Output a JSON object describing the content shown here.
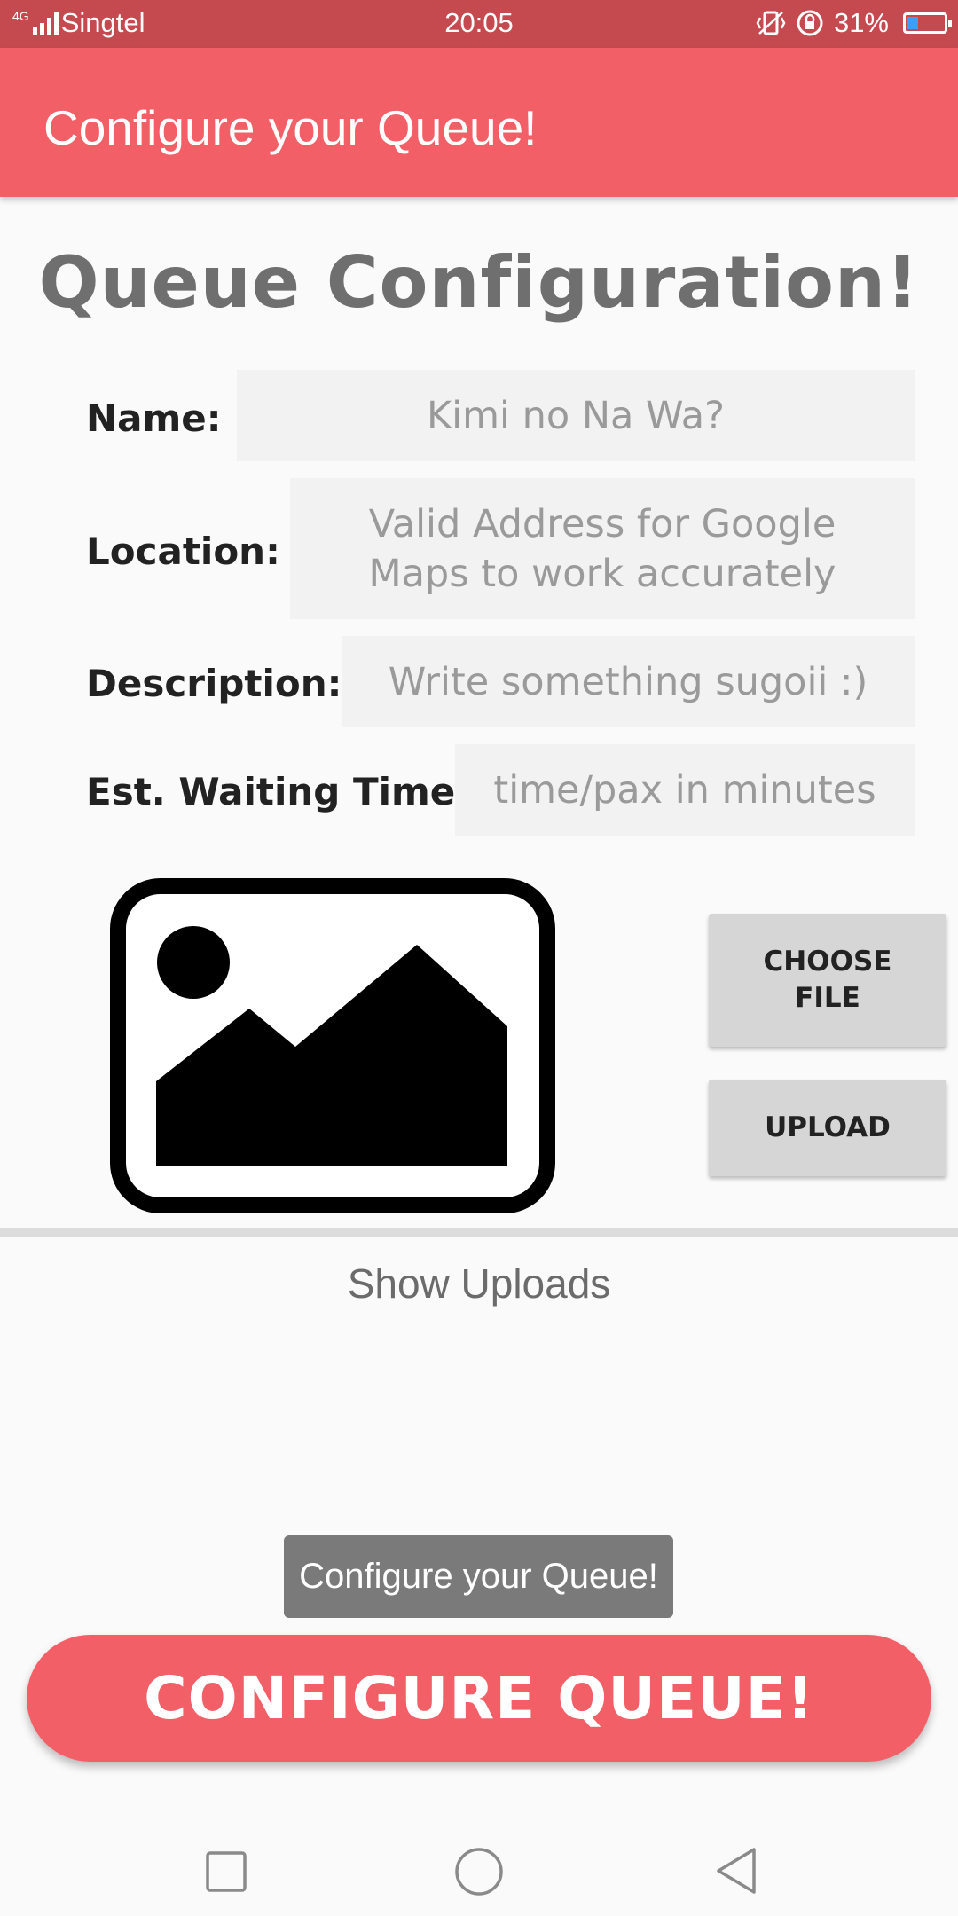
{
  "status_bar": {
    "network": "4G",
    "carrier": "Singtel",
    "time": "20:05",
    "battery": "31%",
    "battery_level": 0.31,
    "icons": [
      "signal-icon",
      "vibrate-icon",
      "rotation-lock-icon",
      "battery-charging-icon"
    ]
  },
  "app_bar": {
    "title": "Configure your Queue!"
  },
  "heading": "Queue Configuration!",
  "form": {
    "name_label": "Name:",
    "name_placeholder": "Kimi no Na Wa?",
    "location_label": "Location:",
    "location_placeholder_line1": "Valid Address for Google",
    "location_placeholder_line2": "Maps to work accurately",
    "description_label": "Description:",
    "description_placeholder": "Write something sugoii :)",
    "wait_label": "Est. Waiting Time:",
    "wait_placeholder": "time/pax in minutes"
  },
  "image": {
    "icon": "image-placeholder-icon"
  },
  "buttons": {
    "choose_line1": "CHOOSE",
    "choose_line2": "FILE",
    "upload": "UPLOAD",
    "configure": "CONFIGURE QUEUE!"
  },
  "show_uploads": "Show Uploads",
  "toast": "Configure your Queue!",
  "nav": {
    "icons": [
      "recents-square-icon",
      "home-circle-icon",
      "back-triangle-icon"
    ]
  },
  "colors": {
    "status_bar": "#c44a50",
    "accent": "#f25f67",
    "heading": "#6f6f6f",
    "field_bg": "#f2f2f2",
    "button_grey": "#d6d6d6"
  }
}
